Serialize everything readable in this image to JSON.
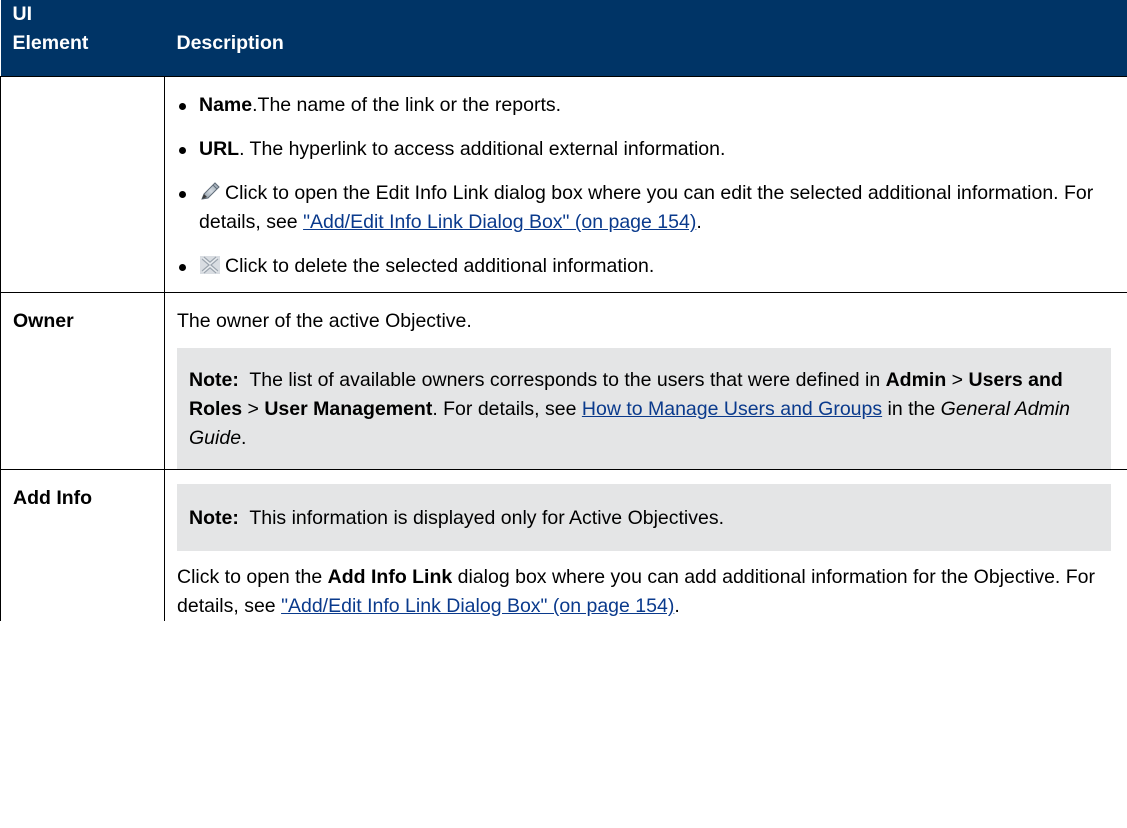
{
  "header": {
    "ui_element": "UI\nElement",
    "description": "Description"
  },
  "rows": {
    "links": {
      "items": {
        "name": {
          "term": "Name",
          "text": ".The name of the link or the reports."
        },
        "url": {
          "term": "URL",
          "text": ". The hyperlink to access additional external information."
        },
        "edit": {
          "icon": "edit-pencil-icon",
          "text": "Click to open the Edit Info Link dialog box where you can edit the selected additional information. For details, see ",
          "link": "\"Add/Edit Info Link Dialog Box\" (on page 154)",
          "after": "."
        },
        "delete": {
          "icon": "delete-x-icon",
          "text": "Click to delete the selected additional information."
        }
      }
    },
    "owner": {
      "element": "Owner",
      "description": "The owner of the active Objective.",
      "note": {
        "label": "Note:",
        "t1": "The list of available owners corresponds to the users that were defined in ",
        "admin": "Admin",
        "sep1": " > ",
        "users_roles": "Users and Roles",
        "sep2": " > ",
        "user_mgmt": "User Management",
        "t2": ". For details, see ",
        "link": "How to Manage Users and Groups",
        "t3": " in the ",
        "guide": "General Admin Guide",
        "t4": "."
      }
    },
    "add_info": {
      "element": "Add Info",
      "note": {
        "label": "Note:",
        "text": "This information is displayed only for Active Objectives."
      },
      "d1": "Click to open the ",
      "dialog": "Add Info Link",
      "d2": " dialog box where you can add additional information for the Objective. For details, see ",
      "link": "\"Add/Edit Info Link Dialog Box\" (on page 154)",
      "d3": "."
    }
  },
  "colors": {
    "header_bg": "#003466",
    "note_bg": "#e4e5e6",
    "link": "#0a3a8c"
  }
}
